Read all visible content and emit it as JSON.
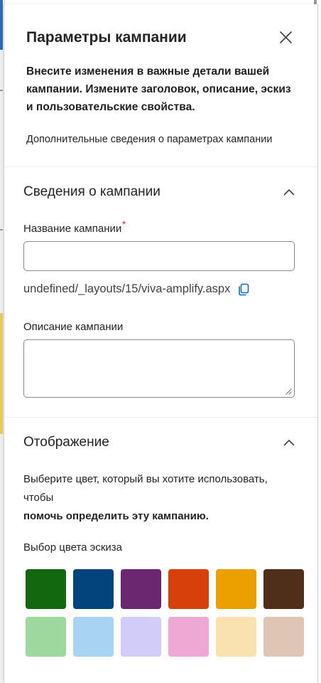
{
  "panel": {
    "title": "Параметры кампании",
    "description": "Внесите изменения в важные детали вашей кампании. Измените заголовок, описание, эскиз и пользовательские свойства.",
    "learn_more": "Дополнительные сведения о параметрах кампании"
  },
  "details_section": {
    "title": "Сведения о кампании",
    "name_label": "Название кампании",
    "required_mark": "*",
    "name_value": "",
    "url": "undefined/_layouts/15/viva-amplify.aspx",
    "description_label": "Описание кампании",
    "description_value": ""
  },
  "display_section": {
    "title": "Отображение",
    "description_part1": "Выберите цвет, который вы хотите использовать, чтобы",
    "description_part2": "помочь определить эту кампанию.",
    "thumbnail_label": "Выбор цвета эскиза",
    "colors": [
      "#13680f",
      "#04447c",
      "#6b2770",
      "#d8400b",
      "#eba000",
      "#4f2f1a",
      "#9fd89f",
      "#a9d3f2",
      "#d2ccf8",
      "#eda9d4",
      "#f9e2af",
      "#dfc5b3"
    ]
  },
  "icons": {
    "close": "close-icon",
    "chevron_up": "chevron-up-icon",
    "copy": "copy-icon",
    "resize": "resize-grip-icon"
  }
}
